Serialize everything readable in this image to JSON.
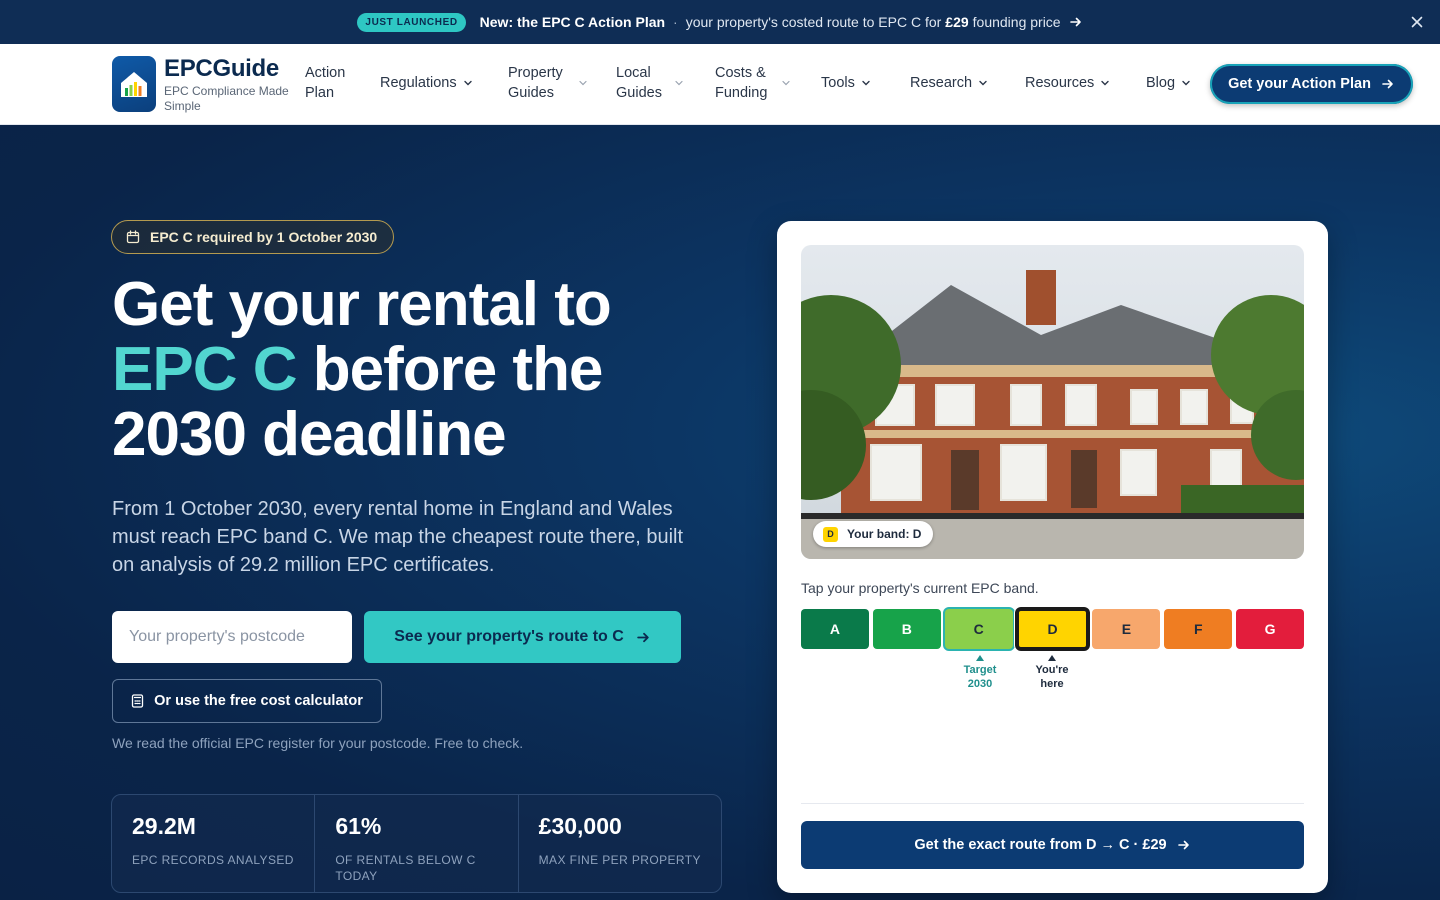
{
  "announce": {
    "pill": "JUST LAUNCHED",
    "headline": "New: the EPC C Action Plan",
    "separator": "·",
    "text_before": "your property's costed route to EPC C for",
    "price": "£29",
    "text_after": "founding price"
  },
  "nav": {
    "logo_name": "EPCGuide",
    "logo_tagline": "EPC Compliance Made Simple",
    "items": [
      {
        "label": "Action Plan"
      },
      {
        "label": "Regulations"
      },
      {
        "label": "Property Guides"
      },
      {
        "label": "Local Guides"
      },
      {
        "label": "Costs & Funding"
      },
      {
        "label": "Tools"
      },
      {
        "label": "Research"
      },
      {
        "label": "Resources"
      },
      {
        "label": "Blog"
      }
    ],
    "cta": "Get your Action Plan"
  },
  "hero": {
    "badge": "EPC C required by 1 October 2030",
    "title_line1": "Get your rental to",
    "title_accent": "EPC C",
    "title_line2_rest": " before the",
    "title_line3": "2030 deadline",
    "lead": "From 1 October 2030, every rental home in England and Wales must reach EPC band C. We map the cheapest route there, built on analysis of 29.2 million EPC certificates.",
    "postcode_placeholder": "Your property's postcode",
    "route_button": "See your property's route to C",
    "calc_button": "Or use the free cost calculator",
    "note": "We read the official EPC register for your postcode. Free to check.",
    "stats": [
      {
        "value": "29.2M",
        "label": "EPC RECORDS ANALYSED"
      },
      {
        "value": "61%",
        "label": "OF RENTALS BELOW C TODAY"
      },
      {
        "value": "£30,000",
        "label": "MAX FINE PER PROPERTY"
      }
    ]
  },
  "card": {
    "band_chip_letter": "D",
    "band_chip_text": "Your band: D",
    "tap_text": "Tap your property's current EPC band.",
    "bands": [
      {
        "letter": "A",
        "color": "#0a7a4a",
        "text_color": "#ffffff"
      },
      {
        "letter": "B",
        "color": "#17a34a",
        "text_color": "#ffffff"
      },
      {
        "letter": "C",
        "color": "#8bcf4b",
        "text_color": "#1e2b3d"
      },
      {
        "letter": "D",
        "color": "#ffd400",
        "text_color": "#1e2b3d"
      },
      {
        "letter": "E",
        "color": "#f7a76c",
        "text_color": "#1e2b3d"
      },
      {
        "letter": "F",
        "color": "#ef7d22",
        "text_color": "#1e2b3d"
      },
      {
        "letter": "G",
        "color": "#e31d3c",
        "text_color": "#ffffff"
      }
    ],
    "target_label_1": "Target",
    "target_label_2": "2030",
    "current_label_1": "You're",
    "current_label_2": "here",
    "cta": "Get the exact route from D → C · £29"
  },
  "colors": {
    "accent_teal": "#32c8c4",
    "navy": "#0c3b73",
    "background": "#0b2a4f"
  }
}
